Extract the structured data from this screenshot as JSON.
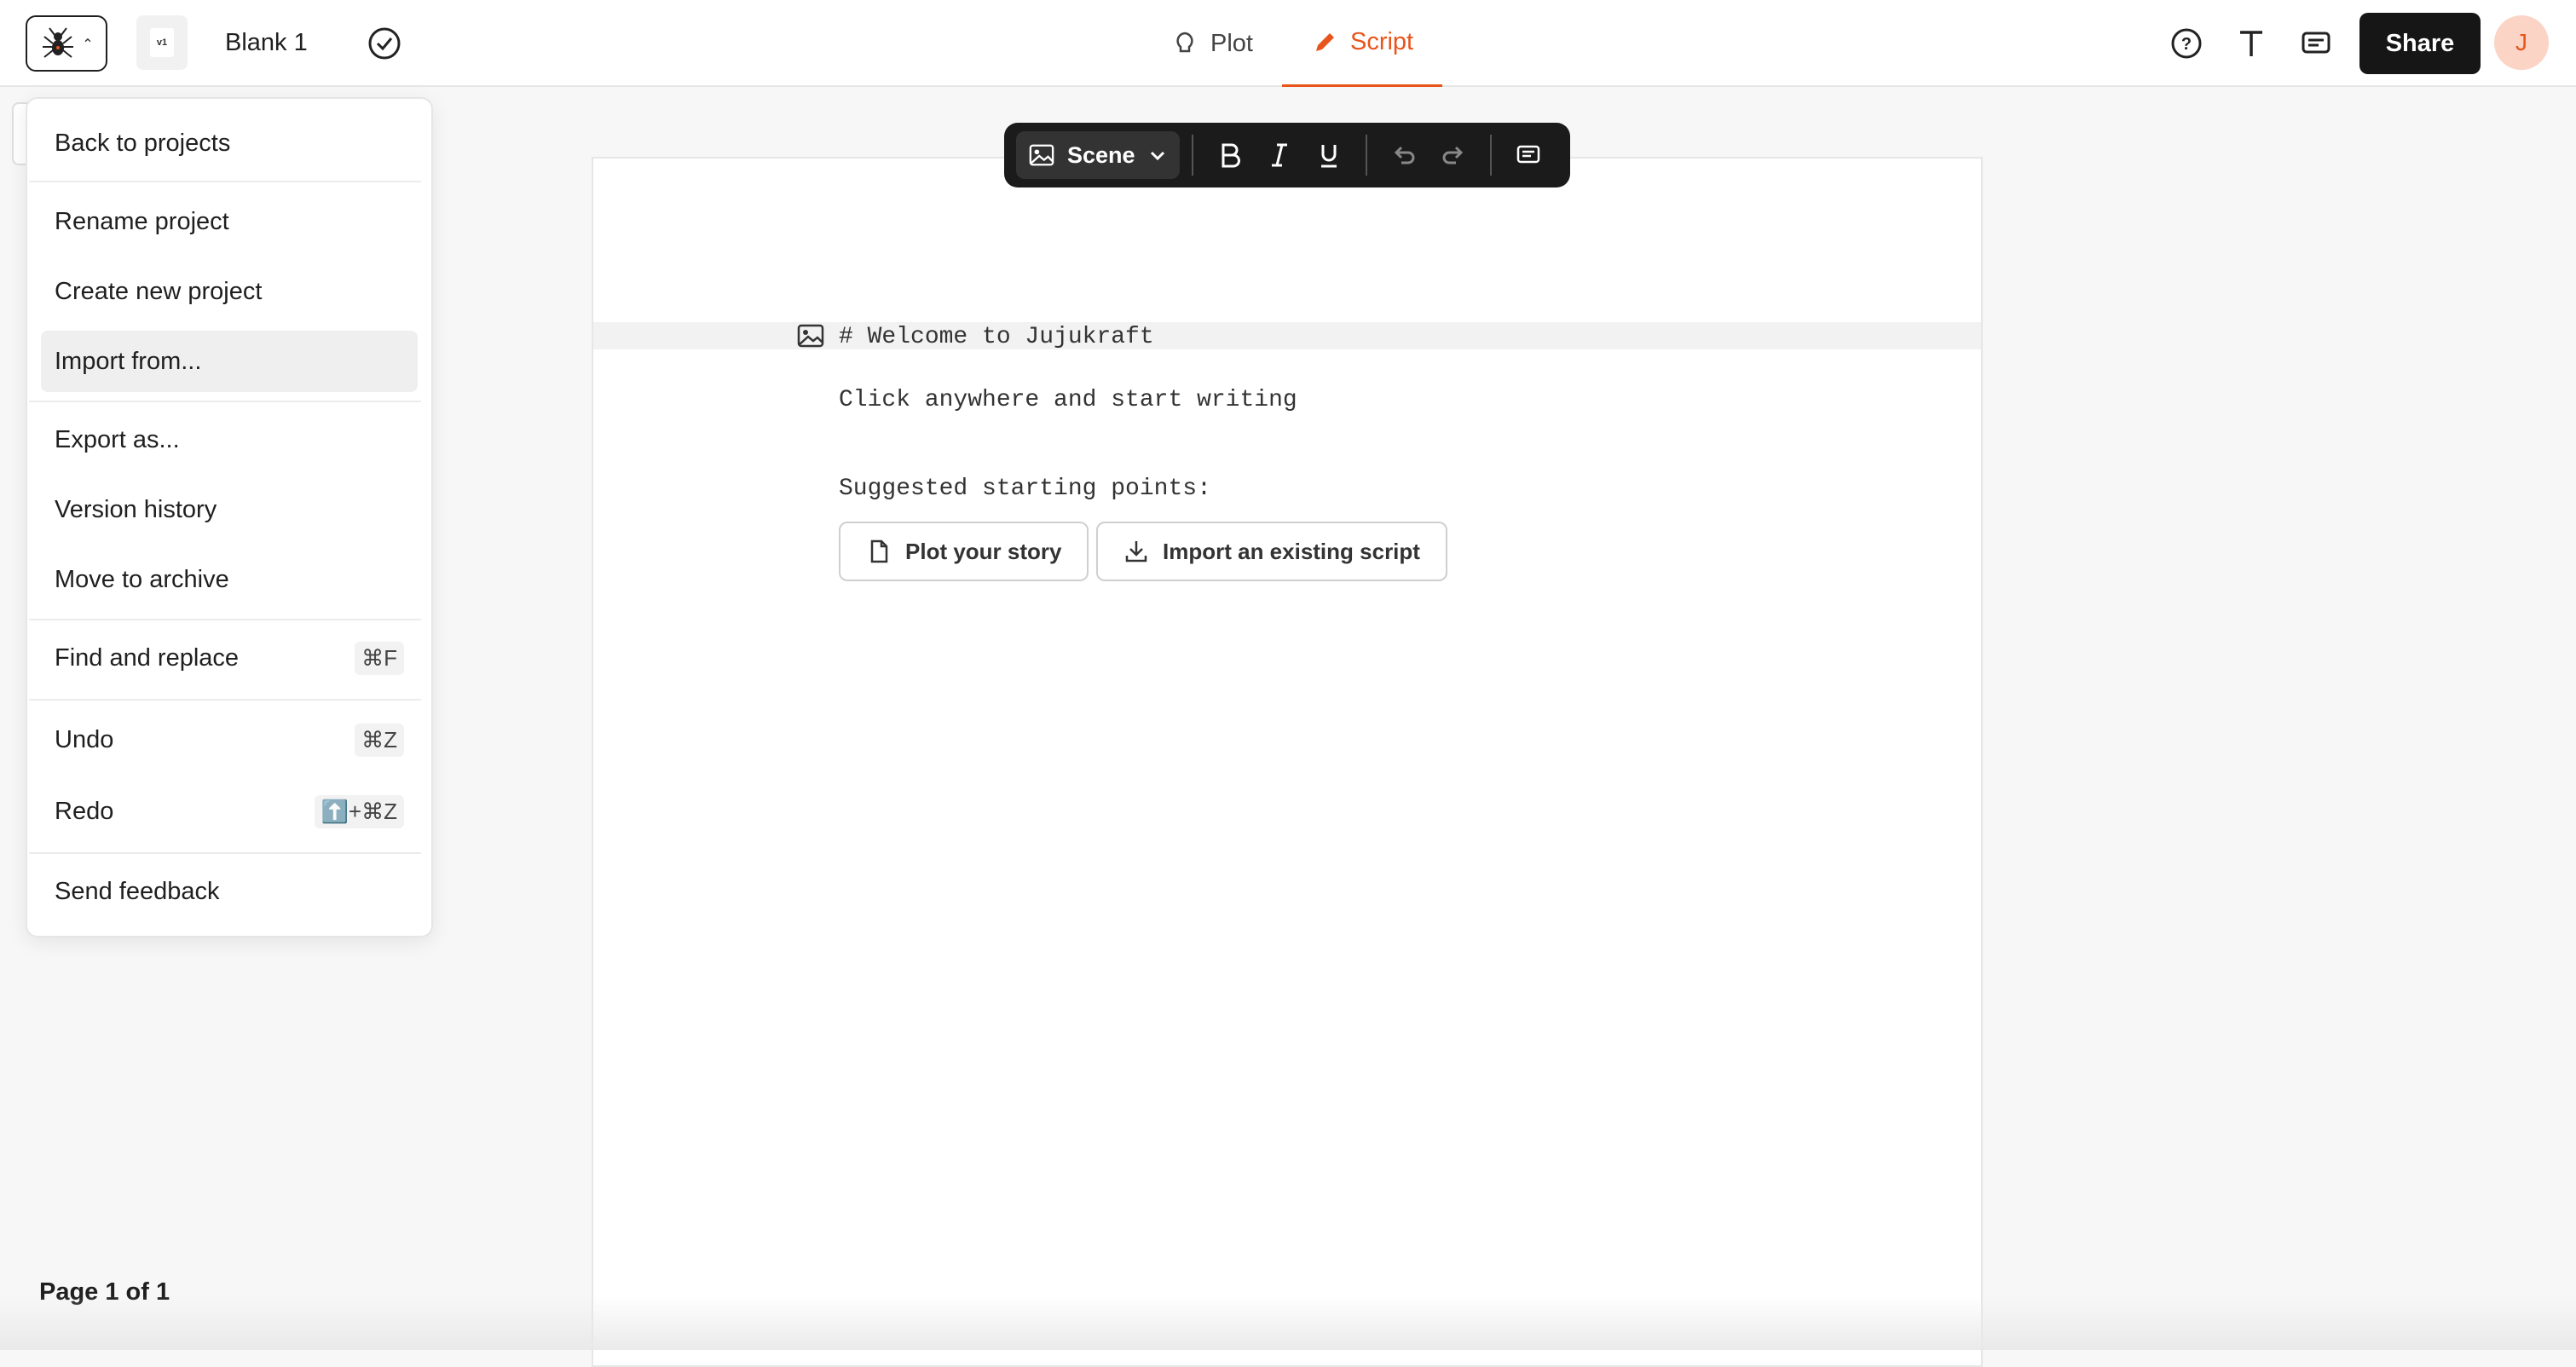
{
  "header": {
    "logo_icon": "spider-logo-icon",
    "version_label": "v1",
    "project_name": "Blank 1",
    "saved_icon": "check-circle-icon",
    "tabs": [
      {
        "label": "Plot",
        "icon": "lightbulb-icon",
        "active": false
      },
      {
        "label": "Script",
        "icon": "pencil-icon",
        "active": true
      }
    ],
    "right_icons": [
      "help-icon",
      "typography-icon",
      "comment-icon"
    ],
    "share_label": "Share",
    "avatar_initial": "J"
  },
  "toolbar": {
    "block_type": "Scene",
    "buttons": [
      "image-icon",
      "bold-icon",
      "italic-icon",
      "underline-icon",
      "undo-icon",
      "redo-icon",
      "comment-icon"
    ]
  },
  "document": {
    "heading": "# Welcome to Jujukraft",
    "intro": "Click anywhere and start writing",
    "suggested_label": "Suggested starting points:",
    "suggestions": [
      {
        "label": "Plot your story",
        "icon": "document-icon"
      },
      {
        "label": "Import an existing script",
        "icon": "download-icon"
      }
    ]
  },
  "menu": {
    "items": [
      {
        "label": "Back to projects",
        "shortcut": ""
      },
      {
        "label": "Rename project",
        "shortcut": ""
      },
      {
        "label": "Create new project",
        "shortcut": ""
      },
      {
        "label": "Import from...",
        "shortcut": "",
        "highlighted": true
      },
      {
        "label": "Export as...",
        "shortcut": ""
      },
      {
        "label": "Version history",
        "shortcut": ""
      },
      {
        "label": "Move to archive",
        "shortcut": ""
      },
      {
        "label": "Find and replace",
        "shortcut": "⌘F"
      },
      {
        "label": "Undo",
        "shortcut": "⌘Z"
      },
      {
        "label": "Redo",
        "shortcut": "⬆️+⌘Z"
      },
      {
        "label": "Send feedback",
        "shortcut": ""
      }
    ]
  },
  "footer": {
    "page_info": "Page 1 of 1"
  },
  "colors": {
    "accent": "#e8551c",
    "avatar_bg": "#fbd4c5",
    "toolbar_bg": "#1b1b1b",
    "share_bg": "#161616"
  }
}
